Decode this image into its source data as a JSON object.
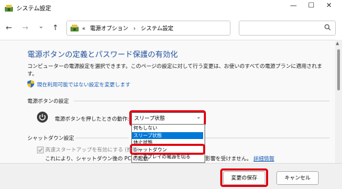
{
  "window": {
    "title": "システム設定",
    "min_glyph": "—",
    "max_glyph": "☐",
    "close_glyph": "✕"
  },
  "nav": {
    "back_glyph": "←",
    "forward_glyph": "→",
    "history_glyph": "⌄",
    "up_glyph": "↑",
    "address": {
      "prefix": "«",
      "crumbs": [
        "電源オプション",
        "システム設定"
      ],
      "separator": "›",
      "dropdown_glyph": "⌄",
      "refresh_glyph": "↻"
    },
    "search_placeholder": ""
  },
  "main": {
    "heading": "電源ボタンの定義とパスワード保護の有効化",
    "description": "コンピューターの電源設定を選択できます。このページの設定に対して行う変更は、お使いのすべての電源プランに適用されます。",
    "change_unavailable_link": "現在利用可能ではない設定を変更します",
    "power_button_section": "電源ボタンの設定",
    "power_button_label": "電源ボタンを押したときの動作:",
    "power_select": {
      "value": "スリープ状態",
      "arrow": "⌄",
      "options": [
        {
          "label": "何もしない",
          "selected": false
        },
        {
          "label": "スリープ状態",
          "selected": true
        },
        {
          "label": "休止状態",
          "selected": false
        },
        {
          "label": "シャットダウン",
          "selected": false
        },
        {
          "label": "ディスプレイの電源を切る",
          "selected": false
        }
      ]
    },
    "shutdown_section": "シャットダウン設定",
    "fast_startup_label": "高速スタートアップを有効にする (推奨)",
    "fast_startup_checked": true,
    "note_left": "これにより、シャットダウン後の PC の起動",
    "note_right": "影響を受けません。",
    "detail_link": "詳細情報"
  },
  "footer": {
    "save_label": "変更の保存",
    "cancel_label": "キャンセル"
  },
  "colors": {
    "highlight": "#e00012",
    "heading": "#1e4e9c",
    "link": "#1a5fb4",
    "selected_option": "#0078d7"
  }
}
